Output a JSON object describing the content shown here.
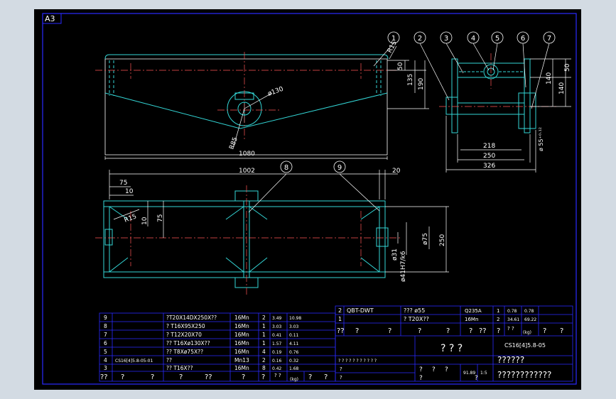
{
  "sheet": {
    "format": "A3",
    "colors": {
      "background": "#000000",
      "frame": "#2a2aff",
      "part": "#33d6d6",
      "dim": "#ffffff",
      "window": "#d3dbe3"
    }
  },
  "balloons": [
    "1",
    "2",
    "3",
    "4",
    "5",
    "6",
    "7",
    "8",
    "9"
  ],
  "front_view_dims": {
    "r15": "R15",
    "d50": "50",
    "d135": "135",
    "d190": "190",
    "phi130": "ø130",
    "r85": "R85",
    "len1080": "1080"
  },
  "side_view_dims": {
    "d50": "50",
    "d140a": "140",
    "d140b": "140",
    "d218": "218",
    "d250": "250",
    "d326": "326",
    "phi55": "ø 55⁺⁰·¹²"
  },
  "plan_view_dims": {
    "d1002": "1002",
    "d20": "20",
    "d75a": "75",
    "d10a": "10",
    "r15": "R15",
    "d10b": "10",
    "d75b": "75",
    "phi75": "ø75",
    "phi31": "ø31",
    "phi41": "ø41H7/k6",
    "d250": "250"
  },
  "bom_left": {
    "rows": [
      {
        "no": "9",
        "code": "",
        "name": "?T20X14DX250X??",
        "mat": "16Mn",
        "qty": "2",
        "w1": "3.49",
        "w2": "10.98"
      },
      {
        "no": "8",
        "code": "",
        "name": "? T16X95X250",
        "mat": "16Mn",
        "qty": "1",
        "w1": "3.03",
        "w2": "3.03"
      },
      {
        "no": "7",
        "code": "",
        "name": "? T12X20X70",
        "mat": "16Mn",
        "qty": "1",
        "w1": "0.41",
        "w2": "0.11"
      },
      {
        "no": "6",
        "code": "",
        "name": "?? T16Xø130X??",
        "mat": "16Mn",
        "qty": "1",
        "w1": "1.57",
        "w2": "4.11"
      },
      {
        "no": "5",
        "code": "",
        "name": "?? T8Xø75X??",
        "mat": "16Mn",
        "qty": "4",
        "w1": "0.19",
        "w2": "0.76"
      },
      {
        "no": "4",
        "code": "CS16[4]5.8-05-01",
        "name": "??",
        "mat": "Mn13",
        "qty": "2",
        "w1": "0.16",
        "w2": "0.32"
      },
      {
        "no": "3",
        "code": "",
        "name": "?? T16X??",
        "mat": "16Mn",
        "qty": "8",
        "w1": "0.42",
        "w2": "1.68"
      }
    ],
    "header": {
      "no": "??",
      "code": "?",
      "c3": "?",
      "name": "?",
      "c5": "??",
      "mat": "?",
      "qty": "?",
      "w": "? ?",
      "unit": "(kg)",
      "c9": "?",
      "c10": "?"
    }
  },
  "bom_right": {
    "rows": [
      {
        "no": "2",
        "code": "QBT-DWT",
        "name": "??? ø55",
        "mat": "Q235A",
        "qty": "1",
        "w1": "0.78",
        "w2": "0.78"
      },
      {
        "no": "1",
        "code": "",
        "name": "? T20X??",
        "mat": "16Mn",
        "qty": "2",
        "w1": "34.61",
        "w2": "69.22"
      }
    ],
    "header": {
      "no": "??",
      "code": "?",
      "c3": "?",
      "name": "?",
      "c5": "?",
      "mat": "?",
      "c7": "??",
      "qty": "?",
      "w": "? ?",
      "unit": "(kg)",
      "c9": "?",
      "c10": "?"
    }
  },
  "title_block": {
    "title": "? ? ?",
    "drawing_no": "CS16[4]5.8-05",
    "company": "??????",
    "bottom_code": "????????????",
    "weight": "91.89",
    "scale": "1:5",
    "mark_row": "? ? ? ? ? ? ? ?  ? ? ?",
    "misc": "?"
  }
}
